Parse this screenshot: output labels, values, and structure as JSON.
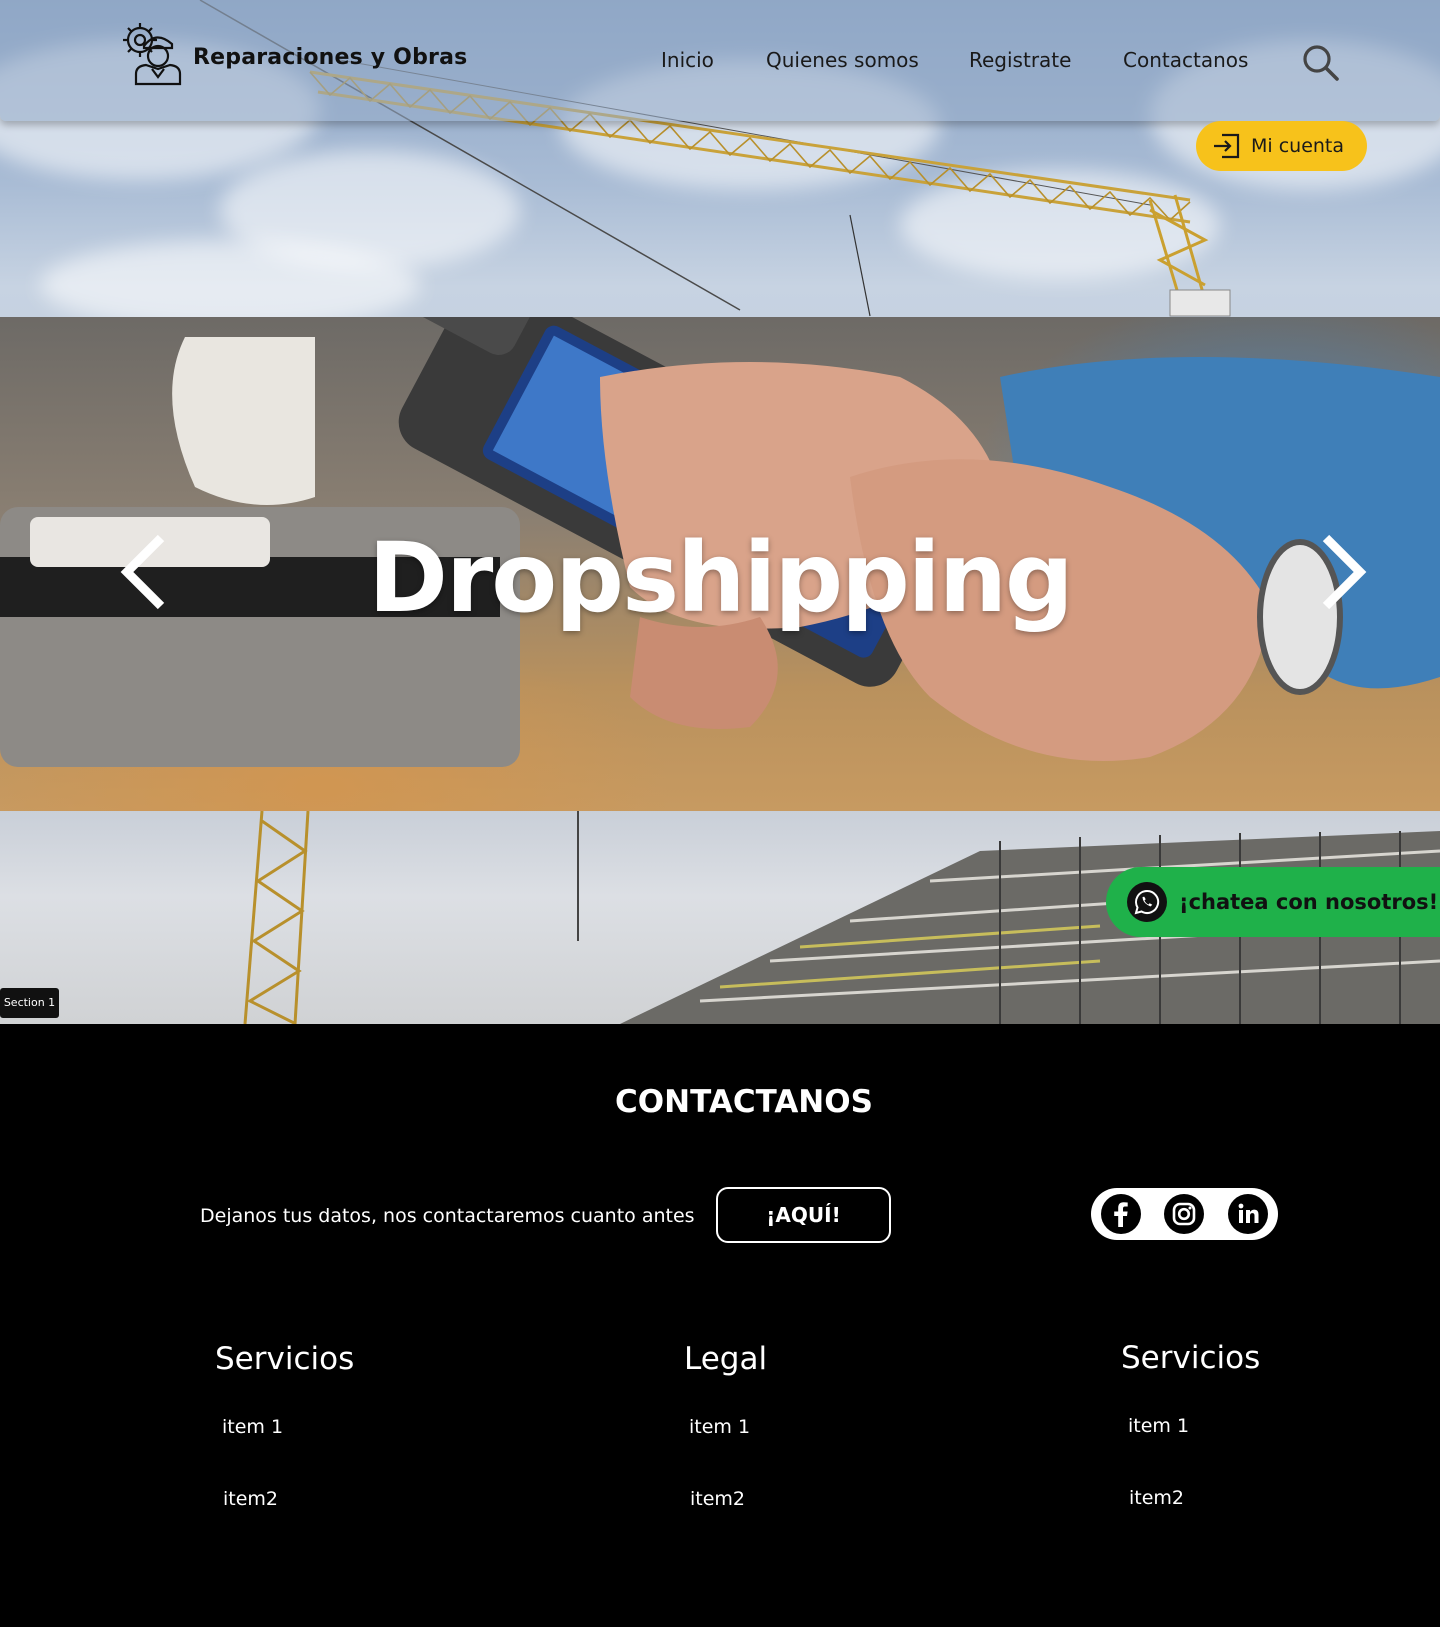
{
  "header": {
    "brand": "Reparaciones y Obras",
    "nav": [
      "Inicio",
      "Quienes somos",
      "Registrate",
      "Contactanos"
    ],
    "account_label": "Mi cuenta"
  },
  "icons": {
    "logo": "engineer-gear-icon",
    "search": "search-icon",
    "account": "login-icon",
    "prev": "chevron-left-icon",
    "next": "chevron-right-icon",
    "chat": "whatsapp-icon",
    "social": [
      "facebook-icon",
      "instagram-icon",
      "linkedin-icon"
    ]
  },
  "carousel": {
    "title": "Dropshipping"
  },
  "section": {
    "tag": "Section 1",
    "chat_label": "¡chatea con nosotros!"
  },
  "footer": {
    "title": "CONTACTANOS",
    "text": "Dejanos tus datos, nos contactaremos cuanto antes",
    "cta": "¡AQUÍ!",
    "columns": [
      {
        "title": "Servicios",
        "items": [
          "item 1",
          "item2"
        ]
      },
      {
        "title": "Legal",
        "items": [
          "item 1",
          "item2"
        ]
      },
      {
        "title": "Servicios",
        "items": [
          "item 1",
          "item2"
        ]
      }
    ]
  },
  "colors": {
    "accent_yellow": "#f7c21b",
    "whatsapp_green": "#1fb14a",
    "footer_bg": "#000000"
  }
}
